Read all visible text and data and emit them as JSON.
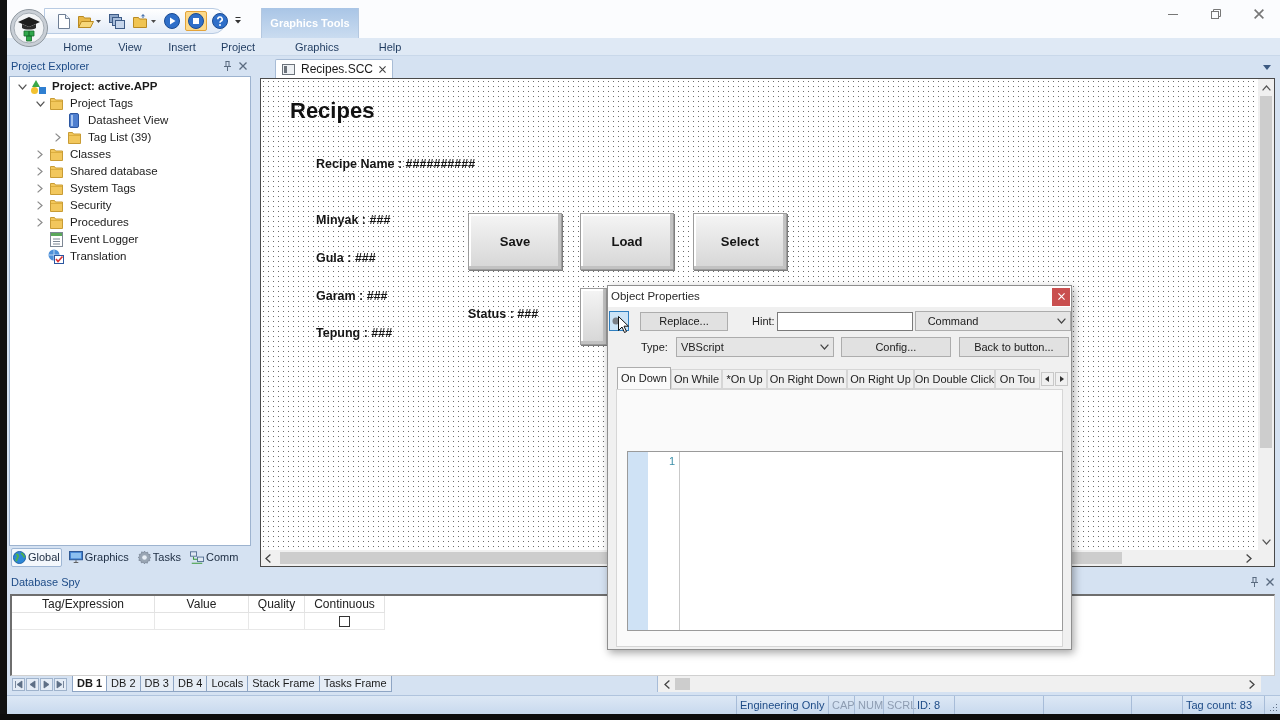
{
  "quick_access": [
    {
      "kind": "new",
      "active": false
    },
    {
      "kind": "open",
      "active": false
    },
    {
      "kind": "windows",
      "active": false
    },
    {
      "kind": "folder",
      "active": false
    },
    {
      "kind": "play",
      "active": false
    },
    {
      "kind": "stop",
      "active": true
    },
    {
      "kind": "help",
      "active": false
    }
  ],
  "ribbon": {
    "tabs_before": [
      "Home",
      "View",
      "Insert",
      "Project"
    ],
    "contextual": {
      "title": "Graphics Tools",
      "tabs": [
        "Graphics"
      ]
    },
    "tabs_after": [
      "Help"
    ]
  },
  "project_explorer": {
    "title": "Project Explorer",
    "tree": [
      {
        "label": "Project: active.APP",
        "kind": "project",
        "expanded": true,
        "children": [
          {
            "label": "Project Tags",
            "kind": "folder",
            "expanded": true,
            "children": [
              {
                "label": "Datasheet View",
                "kind": "sheet"
              },
              {
                "label": "Tag List (39)",
                "kind": "folder",
                "expanded": false
              }
            ]
          },
          {
            "label": "Classes",
            "kind": "folder",
            "expanded": false
          },
          {
            "label": "Shared database",
            "kind": "folder",
            "expanded": false
          },
          {
            "label": "System Tags",
            "kind": "folder",
            "expanded": false
          },
          {
            "label": "Security",
            "kind": "folder",
            "expanded": false
          },
          {
            "label": "Procedures",
            "kind": "folder",
            "expanded": false
          },
          {
            "label": "Event Logger",
            "kind": "log"
          },
          {
            "label": "Translation",
            "kind": "translation"
          }
        ]
      }
    ],
    "tabs": [
      {
        "label": "Global",
        "kind": "globe",
        "selected": true
      },
      {
        "label": "Graphics",
        "kind": "monitor",
        "selected": false
      },
      {
        "label": "Tasks",
        "kind": "gear",
        "selected": false
      },
      {
        "label": "Comm",
        "kind": "network",
        "selected": false
      }
    ]
  },
  "document_tabs": [
    {
      "label": "Recipes.SCC",
      "selected": true
    }
  ],
  "screen": {
    "title": "Recipes",
    "labels": [
      "Recipe Name : ##########",
      "Minyak : ###",
      "Gula : ###",
      "Garam : ###",
      "Tepung : ###",
      "Status : ###"
    ],
    "buttons": [
      "Save",
      "Load",
      "Select"
    ]
  },
  "object_properties": {
    "title": "Object Properties",
    "pinned": true,
    "replace_button": "Replace...",
    "hint_label": "Hint:",
    "action": "Command",
    "type_label": "Type:",
    "type": "VBScript",
    "config_button": "Config...",
    "back_button": "Back to button...",
    "event_tabs": [
      {
        "label": "On Down",
        "selected": true
      },
      {
        "label": "On While",
        "selected": false
      },
      {
        "label": "*On Up",
        "selected": false
      },
      {
        "label": "On Right Down",
        "selected": false
      },
      {
        "label": "On Right Up",
        "selected": false
      },
      {
        "label": "On Double Click",
        "selected": false
      },
      {
        "label": "On Tou",
        "selected": false
      }
    ],
    "editor": {
      "line_numbers": [
        "1"
      ]
    }
  },
  "database_spy": {
    "title": "Database Spy",
    "columns": [
      "Tag/Expression",
      "Value",
      "Quality",
      "Continuous"
    ],
    "rows": [
      {
        "continuous": {
          "checked": false
        }
      }
    ],
    "tabs": [
      {
        "label": "DB 1",
        "selected": true
      },
      {
        "label": "DB 2",
        "selected": false
      },
      {
        "label": "DB 3",
        "selected": false
      },
      {
        "label": "DB 4",
        "selected": false
      },
      {
        "label": "Locals",
        "selected": false
      },
      {
        "label": "Stack Frame",
        "selected": false
      },
      {
        "label": "Tasks Frame",
        "selected": false
      }
    ]
  },
  "status_bar": {
    "panels": [
      {
        "text": "Engineering Only",
        "disabled": false
      },
      {
        "text": "CAP",
        "disabled": true
      },
      {
        "text": "NUM",
        "disabled": true
      },
      {
        "text": "SCRL",
        "disabled": true
      },
      {
        "text": "ID: 8",
        "disabled": false
      }
    ],
    "tag_count": "Tag count: 83"
  }
}
